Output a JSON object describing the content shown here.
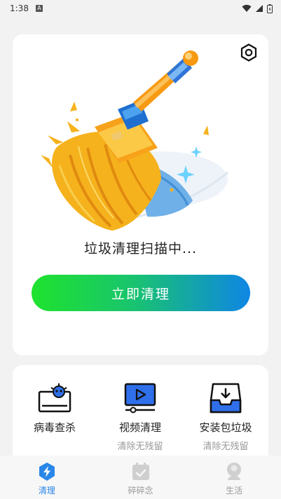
{
  "status_bar": {
    "time": "1:38",
    "notification_badge": "A",
    "icons": [
      "wifi-icon",
      "signal-icon",
      "battery-icon"
    ]
  },
  "main": {
    "scan_text": "垃圾清理扫描中...",
    "clean_button_label": "立即清理",
    "settings_icon": "settings-icon",
    "illustration": "broom-illustration"
  },
  "tools": [
    {
      "label": "病毒查杀",
      "sub": "",
      "icon": "virus-scan-icon"
    },
    {
      "label": "视频清理",
      "sub": "清除无残留",
      "icon": "video-clean-icon"
    },
    {
      "label": "安装包垃圾",
      "sub": "清除无残留",
      "icon": "package-clean-icon"
    }
  ],
  "nav": {
    "items": [
      {
        "label": "清理",
        "icon": "lightning-shield-icon",
        "active": true
      },
      {
        "label": "碎碎念",
        "icon": "calendar-check-icon",
        "active": false
      },
      {
        "label": "生活",
        "icon": "person-icon",
        "active": false
      }
    ]
  },
  "colors": {
    "accent_blue": "#2a86e8",
    "button_gradient_start": "#1fe32e",
    "button_gradient_end": "#0f86e4",
    "tool_icon_blue": "#2f6fea"
  }
}
